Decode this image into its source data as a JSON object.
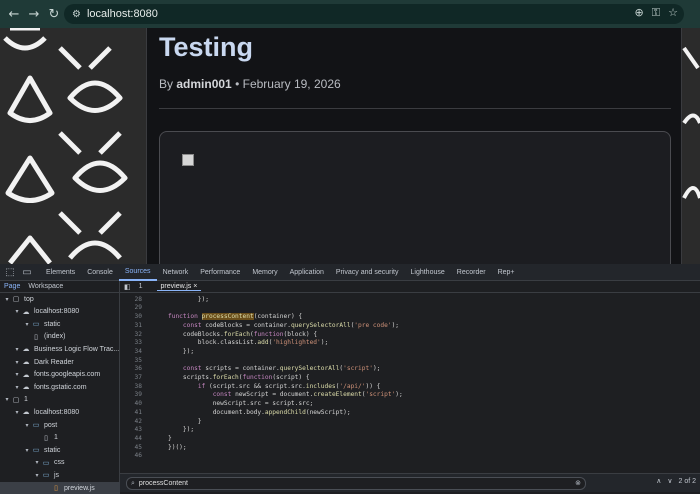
{
  "browser": {
    "url": "localhost:8080",
    "icons": [
      "back-icon",
      "forward-icon",
      "reload-icon",
      "site-info-icon",
      "zoom-icon",
      "password-key-icon",
      "bookmark-star-icon"
    ]
  },
  "page": {
    "title": "Testing",
    "meta_prefix": "By",
    "author": "admin001",
    "separator": "•",
    "date": "February 19, 2026"
  },
  "devtools": {
    "tabs": [
      {
        "label": "Elements",
        "active": false
      },
      {
        "label": "Console",
        "active": false
      },
      {
        "label": "Sources",
        "active": true
      },
      {
        "label": "Network",
        "active": false
      },
      {
        "label": "Performance",
        "active": false
      },
      {
        "label": "Memory",
        "active": false
      },
      {
        "label": "Application",
        "active": false
      },
      {
        "label": "Privacy and security",
        "active": false
      },
      {
        "label": "Lighthouse",
        "active": false
      },
      {
        "label": "Recorder",
        "active": false
      },
      {
        "label": "Rep+",
        "active": false
      }
    ],
    "navigator_tabs": [
      "Page",
      "Workspace"
    ],
    "editor_tabs": {
      "count": "1",
      "file": "preview.js"
    },
    "tree": [
      {
        "label": "top",
        "indent": 0,
        "icon": "frame-icon",
        "selected": false
      },
      {
        "label": "localhost:8080",
        "indent": 1,
        "icon": "cloud-icon",
        "selected": false
      },
      {
        "label": "static",
        "indent": 2,
        "icon": "folder-icon",
        "selected": false
      },
      {
        "label": "(index)",
        "indent": 2,
        "icon": "file-icon",
        "selected": false
      },
      {
        "label": "Business Logic Flow Trac...",
        "indent": 1,
        "icon": "cloud-icon",
        "selected": false
      },
      {
        "label": "Dark Reader",
        "indent": 1,
        "icon": "cloud-icon",
        "selected": false
      },
      {
        "label": "fonts.googleapis.com",
        "indent": 1,
        "icon": "cloud-icon",
        "selected": false
      },
      {
        "label": "fonts.gstatic.com",
        "indent": 1,
        "icon": "cloud-icon",
        "selected": false
      },
      {
        "label": "1",
        "indent": 0,
        "icon": "frame-icon",
        "selected": false
      },
      {
        "label": "localhost:8080",
        "indent": 1,
        "icon": "cloud-icon",
        "selected": false
      },
      {
        "label": "post",
        "indent": 2,
        "icon": "folder-icon",
        "selected": false
      },
      {
        "label": "1",
        "indent": 3,
        "icon": "file-icon",
        "selected": false
      },
      {
        "label": "static",
        "indent": 2,
        "icon": "folder-icon",
        "selected": false
      },
      {
        "label": "css",
        "indent": 3,
        "icon": "folder-icon",
        "selected": false
      },
      {
        "label": "js",
        "indent": 3,
        "icon": "folder-icon",
        "selected": false
      },
      {
        "label": "preview.js",
        "indent": 4,
        "icon": "js-file-icon",
        "selected": true
      }
    ],
    "code": [
      {
        "ln": "28",
        "text": "        });"
      },
      {
        "ln": "29",
        "text": ""
      },
      {
        "ln": "30",
        "pre": "function ",
        "hl": "processContent",
        "post": "(container) {"
      },
      {
        "ln": "31",
        "text": "    const codeBlocks = container.querySelectorAll('pre code');"
      },
      {
        "ln": "32",
        "text": "    codeBlocks.forEach(function(block) {"
      },
      {
        "ln": "33",
        "text": "        block.classList.add('highlighted');"
      },
      {
        "ln": "34",
        "text": "    });"
      },
      {
        "ln": "35",
        "text": ""
      },
      {
        "ln": "36",
        "text": "    const scripts = container.querySelectorAll('script');"
      },
      {
        "ln": "37",
        "text": "    scripts.forEach(function(script) {"
      },
      {
        "ln": "38",
        "text": "        if (script.src && script.src.includes('/api/')) {"
      },
      {
        "ln": "39",
        "text": "            const newScript = document.createElement('script');"
      },
      {
        "ln": "40",
        "text": "            newScript.src = script.src;"
      },
      {
        "ln": "41",
        "text": "            document.body.appendChild(newScript);"
      },
      {
        "ln": "42",
        "text": "        }"
      },
      {
        "ln": "43",
        "text": "    });"
      },
      {
        "ln": "44",
        "text": "}"
      },
      {
        "ln": "45",
        "text": "})();"
      },
      {
        "ln": "46",
        "text": ""
      }
    ],
    "search": {
      "value": "processContent",
      "result": "2 of 2"
    }
  }
}
